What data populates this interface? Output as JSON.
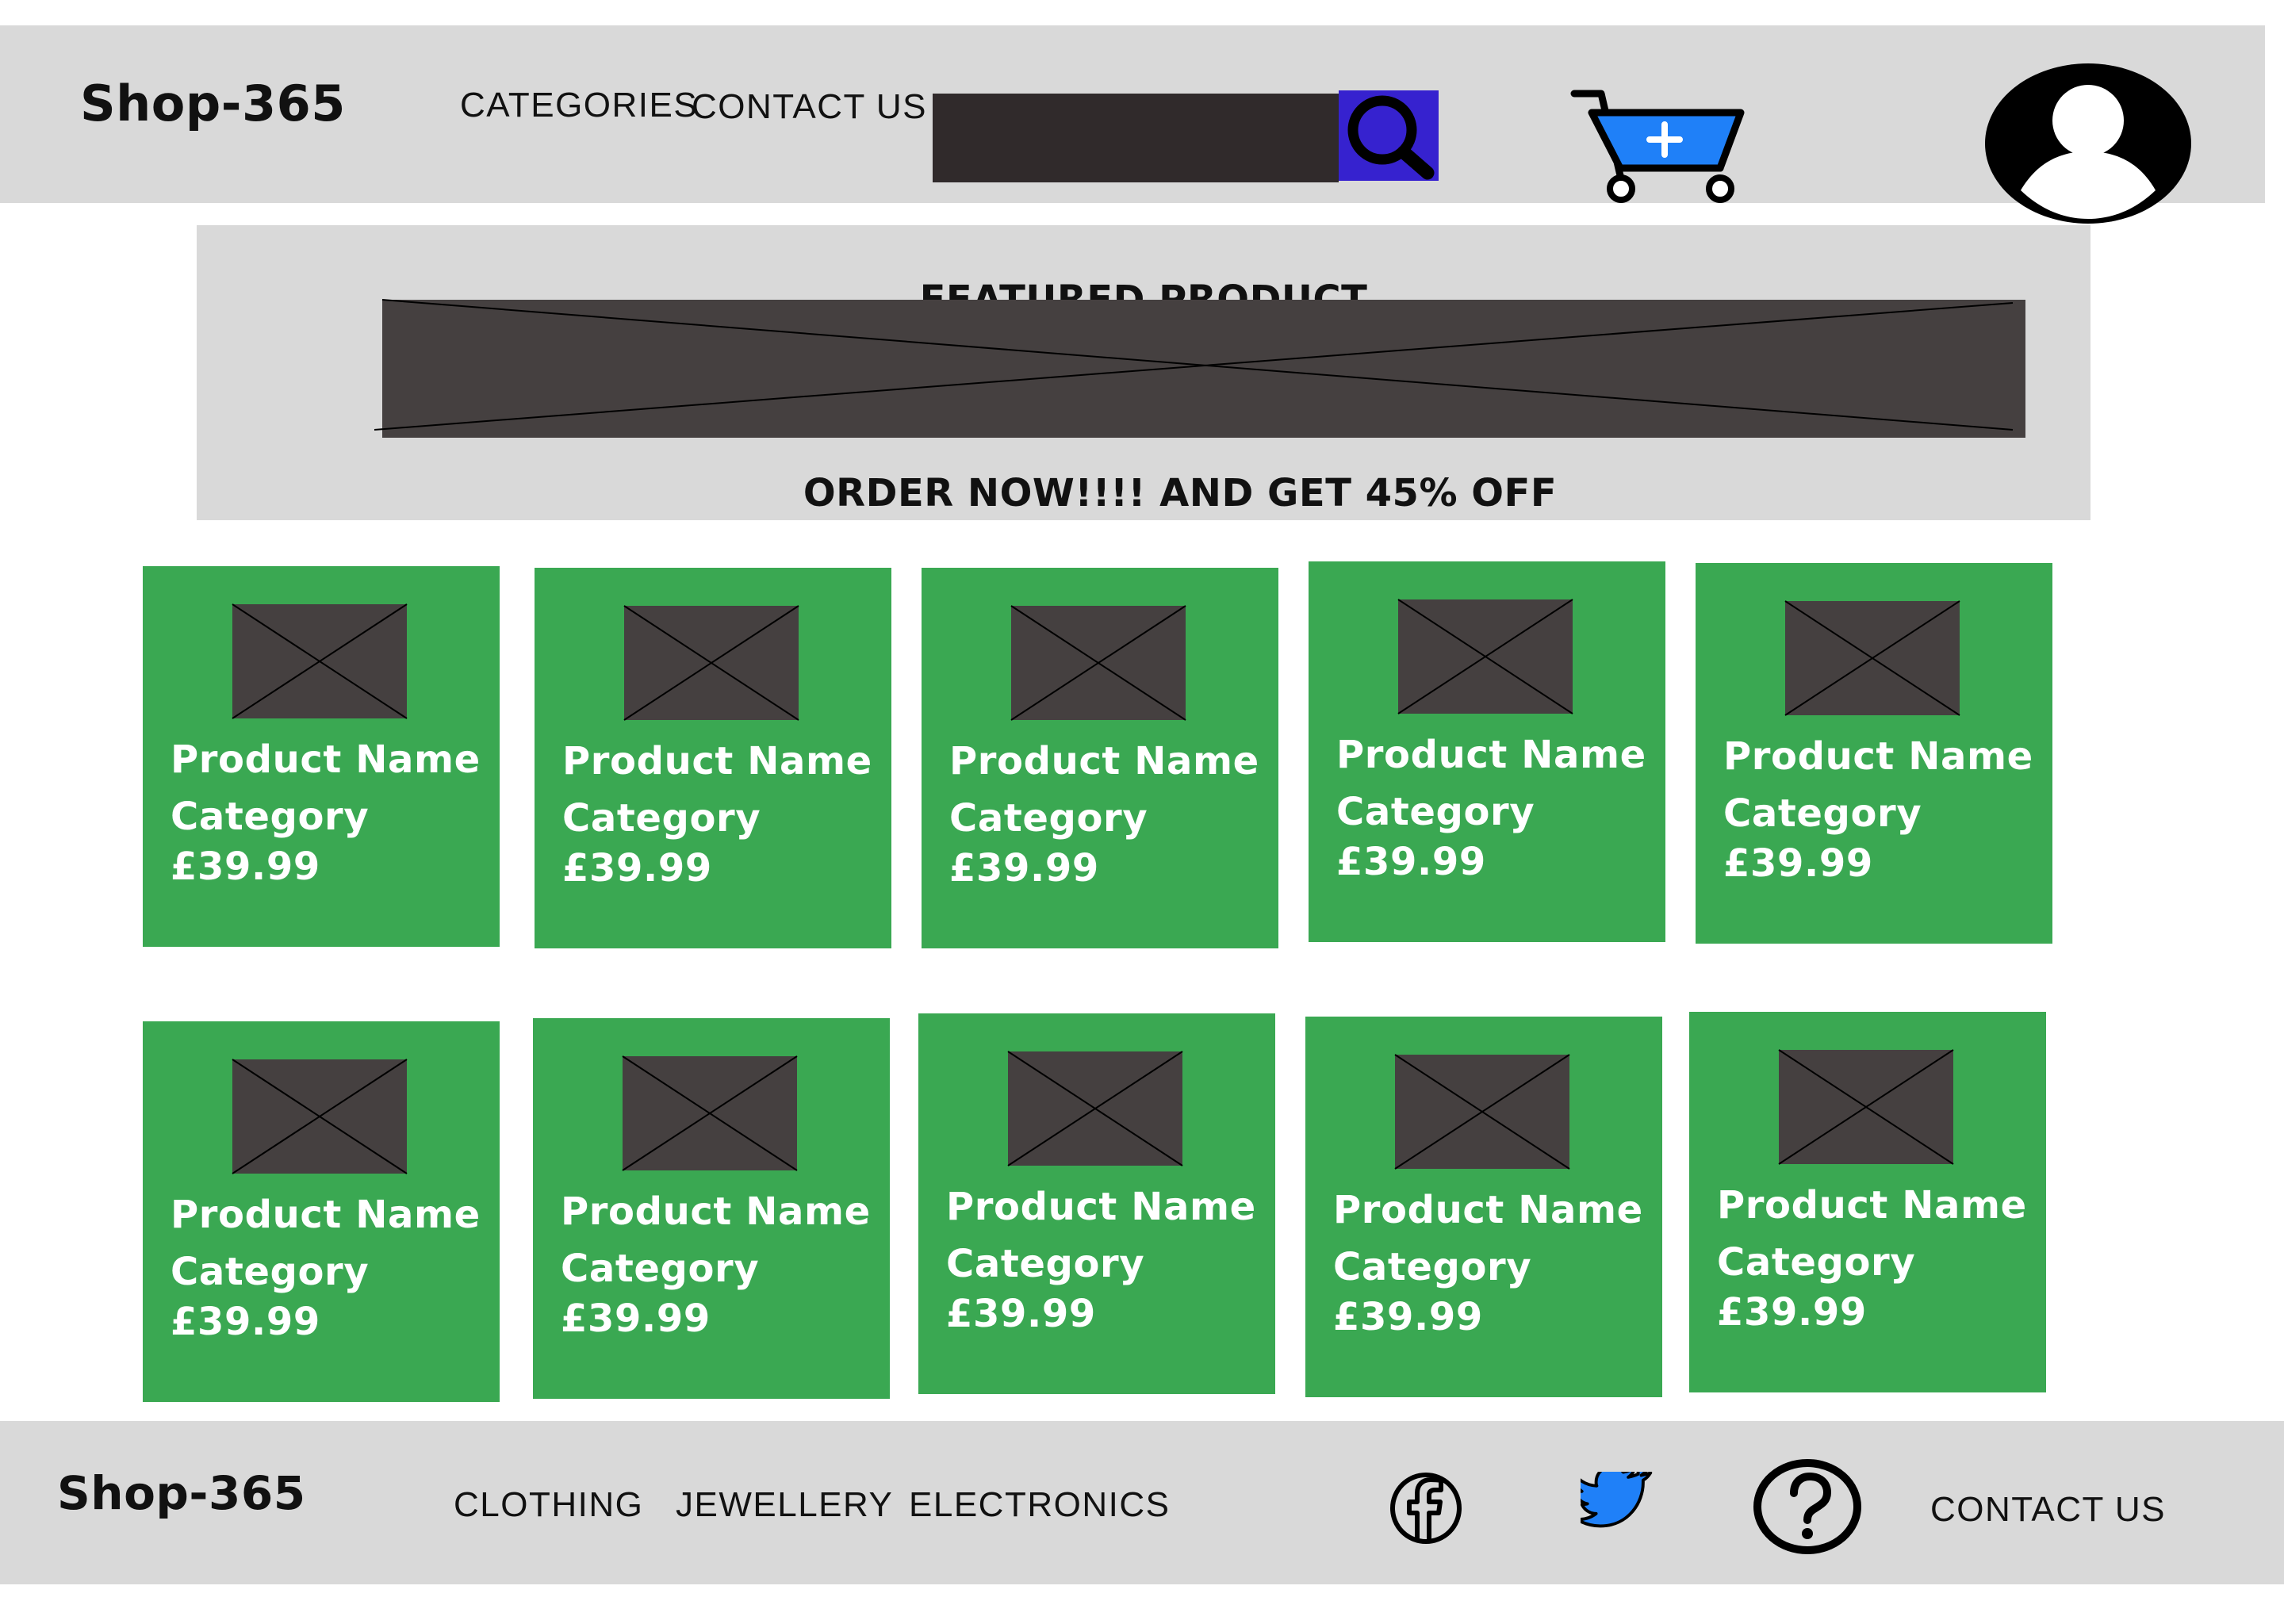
{
  "header": {
    "brand": "Shop-365",
    "nav": {
      "categories": "CATEGORIES",
      "contact": "CONTACT US"
    },
    "search": {
      "value": "",
      "placeholder": ""
    },
    "icons": {
      "search": "search-icon",
      "cart": "add-to-cart-icon",
      "profile": "user-profile-icon"
    }
  },
  "featured": {
    "title": "FEATURED PRODUCT",
    "offer": "ORDER NOW!!!! AND GET 45% OFF"
  },
  "products": [
    {
      "name": "Product Name",
      "category": "Category",
      "price": "£39.99"
    },
    {
      "name": "Product Name",
      "category": "Category",
      "price": "£39.99"
    },
    {
      "name": "Product Name",
      "category": "Category",
      "price": "£39.99"
    },
    {
      "name": "Product Name",
      "category": "Category",
      "price": "£39.99"
    },
    {
      "name": "Product Name",
      "category": "Category",
      "price": "£39.99"
    },
    {
      "name": "Product Name",
      "category": "Category",
      "price": "£39.99"
    },
    {
      "name": "Product Name",
      "category": "Category",
      "price": "£39.99"
    },
    {
      "name": "Product Name",
      "category": "Category",
      "price": "£39.99"
    },
    {
      "name": "Product Name",
      "category": "Category",
      "price": "£39.99"
    },
    {
      "name": "Product Name",
      "category": "Category",
      "price": "£39.99"
    }
  ],
  "footer": {
    "brand": "Shop-365",
    "links": {
      "clothing": "CLOTHING",
      "jewellery": "JEWELLERY",
      "electronics": "ELECTRONICS",
      "contact": "CONTACT US"
    },
    "icons": {
      "facebook": "facebook-icon",
      "twitter": "twitter-icon",
      "help": "help-icon"
    }
  },
  "colors": {
    "bar_background": "#d9d9d9",
    "product_card": "#3aa852",
    "image_placeholder": "#454040",
    "search_field": "#302a2b",
    "search_button": "#3622cf",
    "cart_blue": "#1f80f8"
  }
}
